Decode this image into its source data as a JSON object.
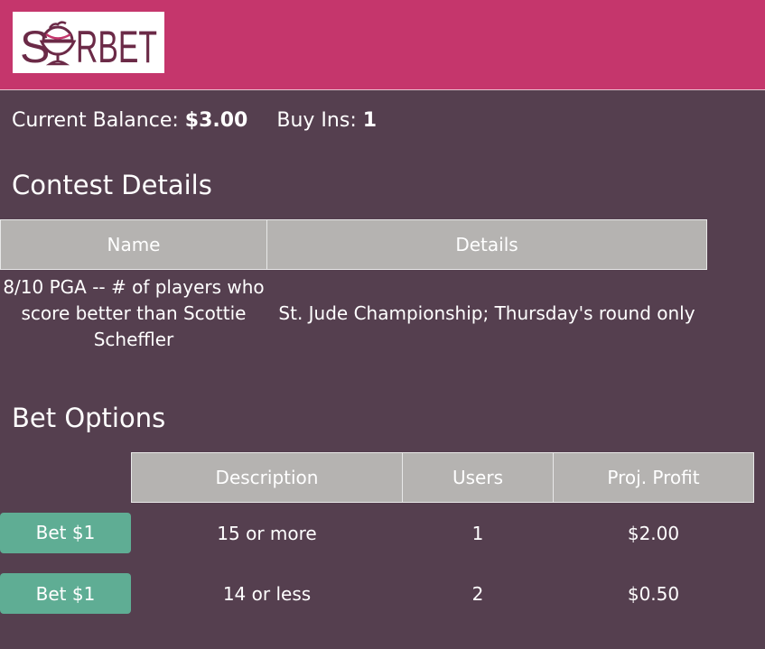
{
  "header": {
    "logo_text": "SORBET"
  },
  "account": {
    "balance_label": "Current Balance:",
    "balance_value": "$3.00",
    "buyins_label": "Buy Ins:",
    "buyins_value": "1"
  },
  "contest": {
    "title": "Contest Details",
    "columns": [
      "Name",
      "Details"
    ],
    "row": {
      "name": "8/10 PGA -- # of players who score better than Scottie Scheffler",
      "details": "St. Jude Championship; Thursday's round only"
    }
  },
  "bets": {
    "title": "Bet Options",
    "columns": [
      "Description",
      "Users",
      "Proj. Profit"
    ],
    "rows": [
      {
        "button": "Bet $1",
        "description": "15 or more",
        "users": "1",
        "profit": "$2.00"
      },
      {
        "button": "Bet $1",
        "description": "14 or less",
        "users": "2",
        "profit": "$0.50"
      }
    ]
  },
  "colors": {
    "header_bg": "#c5366c",
    "page_bg": "#553f4f",
    "table_header_bg": "#b5b3b1",
    "button_bg": "#5fad94",
    "logo_text": "#6b2a47",
    "logo_accent": "#c5366c"
  }
}
